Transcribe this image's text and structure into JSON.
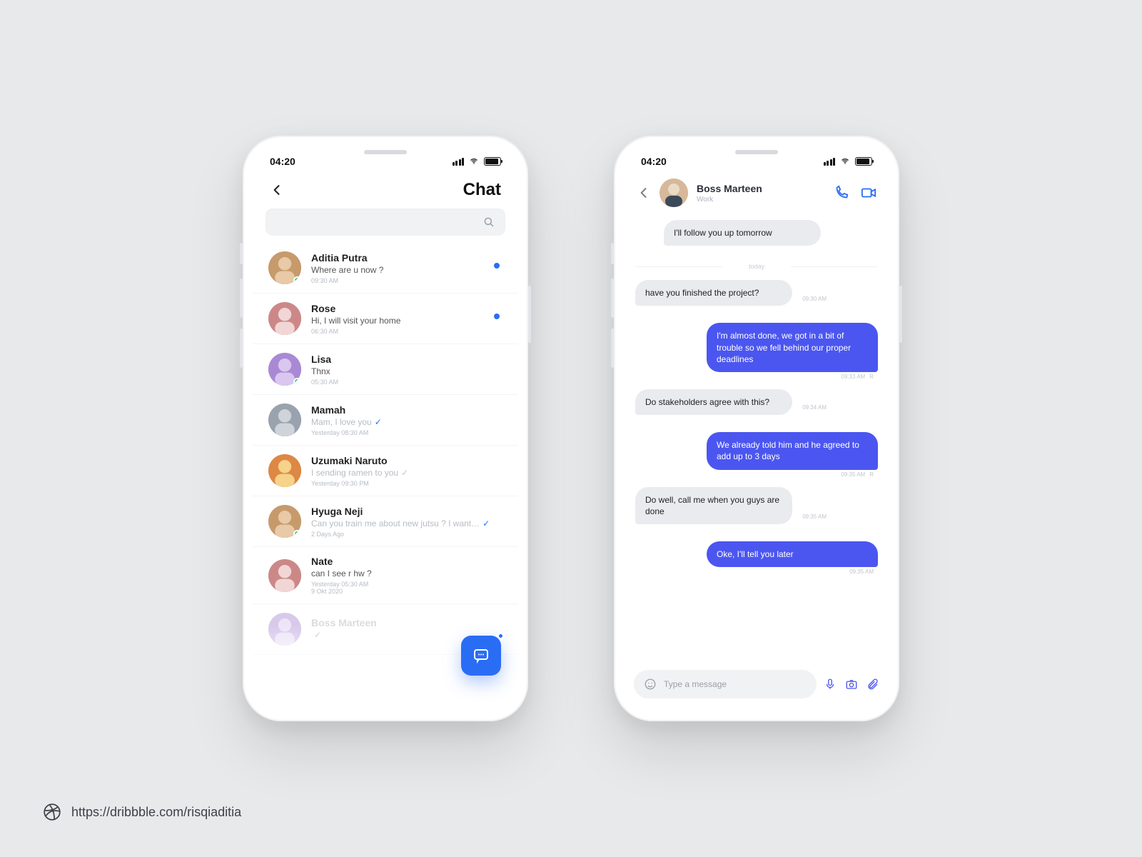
{
  "status": {
    "time": "04:20"
  },
  "chatList": {
    "title": "Chat",
    "search_placeholder": "",
    "items": [
      {
        "name": "Aditia Putra",
        "preview": "Where are u now ?",
        "time": "09:30 AM",
        "unread": true,
        "online": true,
        "read": "none"
      },
      {
        "name": "Rose",
        "preview": "Hi, I will visit your home",
        "time": "06:30 AM",
        "unread": true,
        "online": false,
        "read": "none"
      },
      {
        "name": "Lisa",
        "preview": "Thnx",
        "time": "05:30 AM",
        "unread": false,
        "online": true,
        "read": "none"
      },
      {
        "name": "Mamah",
        "preview": "Mam, I love you",
        "time": "Yesterday  08:30 AM",
        "unread": false,
        "online": false,
        "read": "blue"
      },
      {
        "name": "Uzumaki Naruto",
        "preview": "I sending ramen to you",
        "time": "Yesterday  09:30 PM",
        "unread": false,
        "online": false,
        "read": "grey"
      },
      {
        "name": "Hyuga Neji",
        "preview": "Can you train me about new jutsu ? I want…",
        "time": "2 Days Ago",
        "unread": false,
        "online": true,
        "read": "blue"
      },
      {
        "name": "Nate",
        "preview": "can I see r hw ?",
        "time": "Yesterday  05:30 AM\n9 Okt 2020",
        "unread": false,
        "online": false,
        "read": "none"
      },
      {
        "name": "Boss Marteen",
        "preview": "",
        "time": "",
        "unread": false,
        "online": false,
        "read": "grey",
        "faded": true
      }
    ]
  },
  "conversation": {
    "contact_name": "Boss Marteen",
    "contact_sub": "Work",
    "day_separator": "today",
    "messages": [
      {
        "dir": "in",
        "text": "I'll follow you up tomorrow",
        "time": ""
      },
      {
        "dir": "in",
        "text": "have you finished the project?",
        "time": "09:30 AM"
      },
      {
        "dir": "out",
        "text": "I'm almost done, we got in a bit of trouble so we fell behind our proper deadlines",
        "time": "09:33 AM",
        "status": "R"
      },
      {
        "dir": "in",
        "text": "Do stakeholders agree with this?",
        "time": "09:34 AM"
      },
      {
        "dir": "out",
        "text": "We already told him and he agreed to add up to 3 days",
        "time": "09:35 AM",
        "status": "R"
      },
      {
        "dir": "in",
        "text": "Do well, call me when you guys are done",
        "time": "09:35 AM"
      },
      {
        "dir": "out",
        "text": "Oke, I'll tell you later",
        "time": "09:35 AM"
      }
    ],
    "composer_placeholder": "Type a message"
  },
  "credit": {
    "url": "https://dribbble.com/risqiaditia"
  }
}
